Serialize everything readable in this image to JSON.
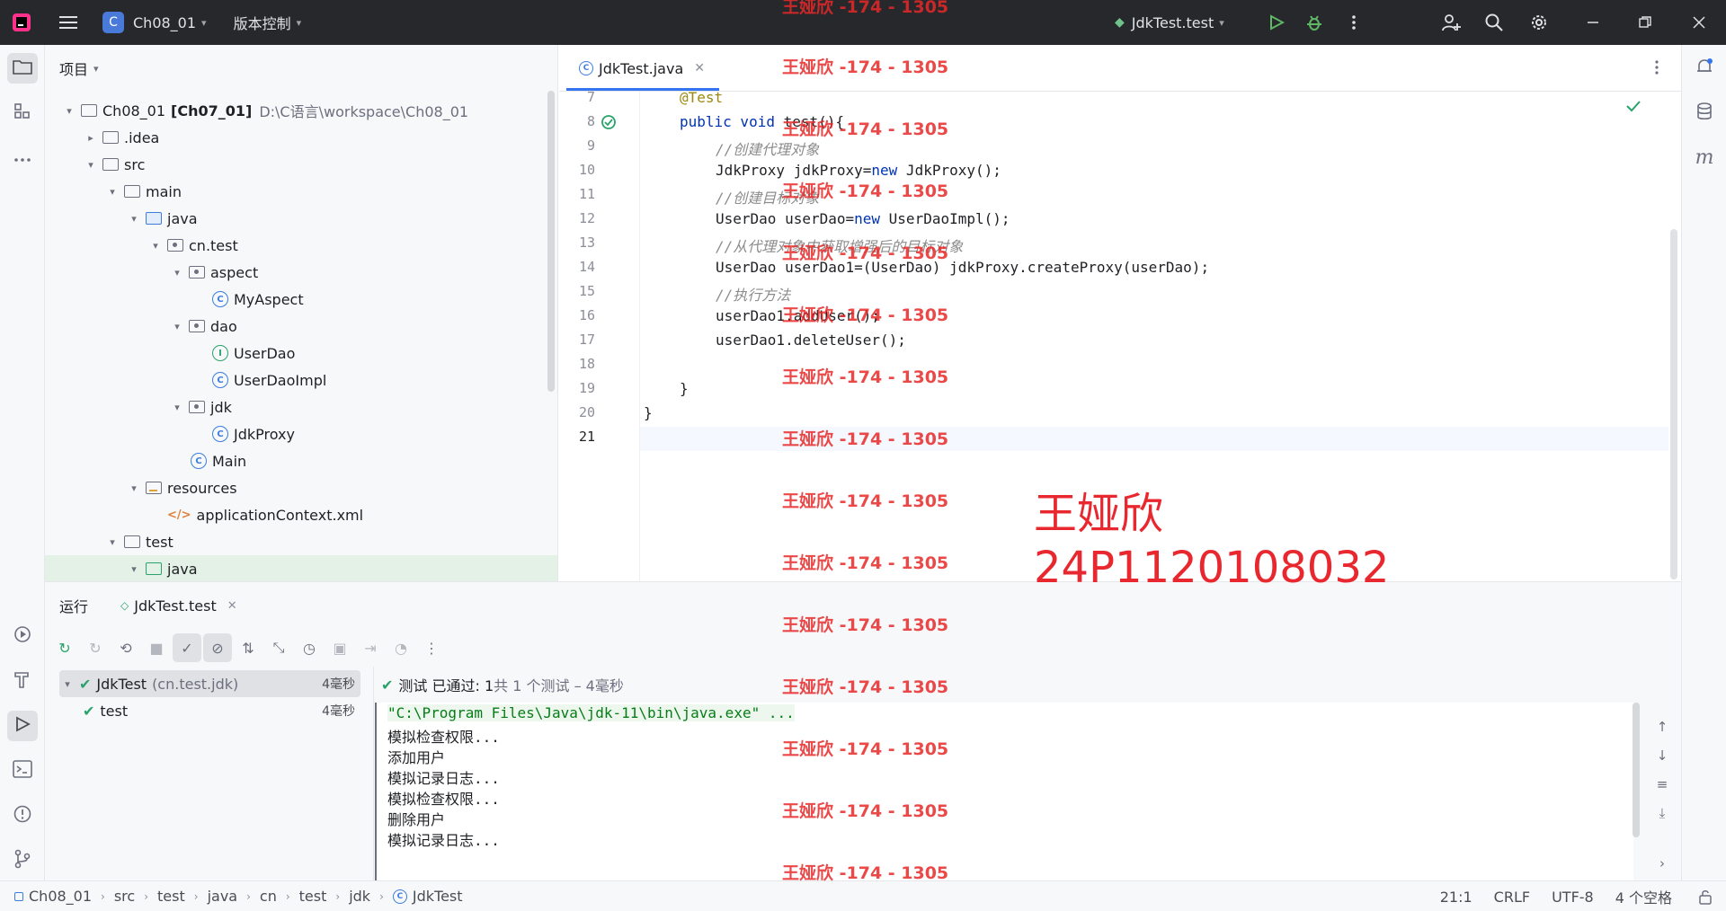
{
  "titlebar": {
    "project_badge": "C",
    "project_name": "Ch08_01",
    "vcs_label": "版本控制",
    "run_config": "JdkTest.test"
  },
  "project_panel": {
    "title": "项目",
    "rows": [
      {
        "label": "Ch08_01",
        "bold": "[Ch07_01]",
        "path": "D:\\C语言\\workspace\\Ch08_01"
      },
      {
        "label": ".idea"
      },
      {
        "label": "src"
      },
      {
        "label": "main"
      },
      {
        "label": "java"
      },
      {
        "label": "cn.test"
      },
      {
        "label": "aspect"
      },
      {
        "label": "MyAspect"
      },
      {
        "label": "dao"
      },
      {
        "label": "UserDao"
      },
      {
        "label": "UserDaoImpl"
      },
      {
        "label": "jdk"
      },
      {
        "label": "JdkProxy"
      },
      {
        "label": "Main"
      },
      {
        "label": "resources"
      },
      {
        "label": "applicationContext.xml"
      },
      {
        "label": "test"
      },
      {
        "label": "java"
      }
    ]
  },
  "editor": {
    "tab_label": "JdkTest.java",
    "line_numbers": [
      "7",
      "8",
      "9",
      "10",
      "11",
      "12",
      "13",
      "14",
      "15",
      "16",
      "17",
      "18",
      "19",
      "20",
      "21"
    ],
    "code": {
      "l7": "@Test",
      "l8_kw": "public void",
      "l8_rest": " test(){",
      "l9": "//创建代理对象",
      "l10_a": "JdkProxy jdkProxy=",
      "l10_kw": "new",
      "l10_b": " JdkProxy();",
      "l11": "//创建目标对象",
      "l12_a": "UserDao userDao=",
      "l12_kw": "new",
      "l12_b": " UserDaoImpl();",
      "l13": "//从代理对象中获取增强后的目标对象",
      "l14": "UserDao userDao1=(UserDao) jdkProxy.createProxy(userDao);",
      "l15": "//执行方法",
      "l16": "userDao1.addUser();",
      "l17": "userDao1.deleteUser();",
      "l19": "}",
      "l20": "}"
    }
  },
  "run_panel": {
    "title": "运行",
    "tab_label": "JdkTest.test",
    "tree": [
      {
        "label": "JdkTest",
        "detail": "(cn.test.jdk)",
        "duration": "4毫秒"
      },
      {
        "label": "test",
        "duration": "4毫秒"
      }
    ],
    "status_prefix": "测试 已通过: 1",
    "status_suffix": "共 1 个测试 – 4毫秒",
    "console_lines": [
      "\"C:\\Program Files\\Java\\jdk-11\\bin\\java.exe\" ...",
      "模拟检查权限...",
      "添加用户",
      "模拟记录日志...",
      "模拟检查权限...",
      "删除用户",
      "模拟记录日志..."
    ]
  },
  "statusbar": {
    "breadcrumbs": [
      "Ch08_01",
      "src",
      "test",
      "java",
      "cn",
      "test",
      "jdk",
      "JdkTest"
    ],
    "position": "21:1",
    "line_ending": "CRLF",
    "encoding": "UTF-8",
    "indent": "4 个空格"
  },
  "watermark": {
    "repeat_text": "王娅欣 -174 - 1305",
    "name": "王娅欣",
    "student_id": "24P1120108032"
  },
  "colors": {
    "accent": "#3574f0",
    "success": "#29a36a",
    "watermark": "#e8282e"
  }
}
